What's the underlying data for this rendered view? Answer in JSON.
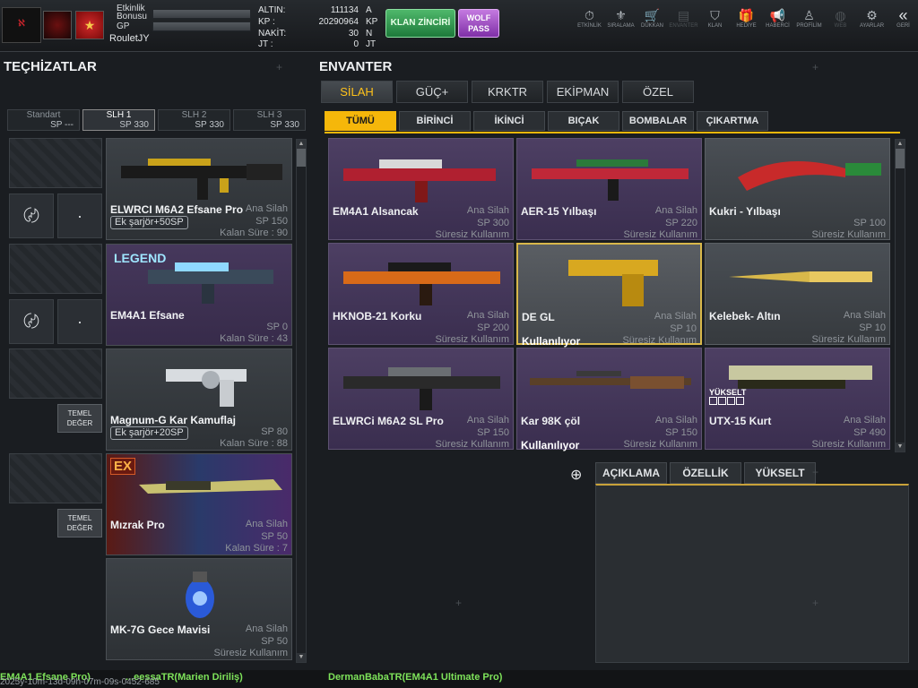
{
  "topbar": {
    "stat_labels": [
      "Etkinlik",
      "Bonusu",
      "GP"
    ],
    "username": "RouletJY",
    "currencies": [
      {
        "label": "ALTIN:",
        "value": "111134",
        "unit": "A"
      },
      {
        "label": "KP  :",
        "value": "20290964",
        "unit": "KP"
      },
      {
        "label": "NAKİT:",
        "value": "30",
        "unit": "N"
      },
      {
        "label": "JT   :",
        "value": "0",
        "unit": "JT"
      }
    ],
    "clan_button": "KLAN ZİNCİRİ",
    "wolf_button_line1": "WOLF",
    "wolf_button_line2": "PASS",
    "nav": [
      {
        "label": "ETKİNLİK",
        "icon": "stopwatch-icon",
        "glyph": "⏱"
      },
      {
        "label": "SIRALAMA",
        "icon": "medal-icon",
        "glyph": "⚜"
      },
      {
        "label": "DÜKKAN",
        "icon": "cart-icon",
        "glyph": "🛒"
      },
      {
        "label": "ENVANTER",
        "icon": "inventory-icon",
        "glyph": "▤"
      },
      {
        "label": "KLAN",
        "icon": "shield-icon",
        "glyph": "⛉"
      },
      {
        "label": "HEDİYE",
        "icon": "gift-icon",
        "glyph": "🎁"
      },
      {
        "label": "HABERCİ",
        "icon": "megaphone-icon",
        "glyph": "📢"
      },
      {
        "label": "PROFİLİM",
        "icon": "profile-icon",
        "glyph": "♙"
      },
      {
        "label": "WEB",
        "icon": "globe-icon",
        "glyph": "◍"
      },
      {
        "label": "AYARLAR",
        "icon": "gear-icon",
        "glyph": "⚙"
      },
      {
        "label": "GERİ",
        "icon": "back-icon",
        "glyph": "«"
      }
    ]
  },
  "left": {
    "title": "TEÇHİZATLAR",
    "loadouts": [
      {
        "name": "Standart",
        "sp": "SP ---"
      },
      {
        "name": "SLH 1",
        "sp": "SP 330"
      },
      {
        "name": "SLH 2",
        "sp": "SP 330"
      },
      {
        "name": "SLH 3",
        "sp": "SP 330"
      }
    ],
    "value_button_line1": "TEMEL",
    "value_button_line2": "DEĞER",
    "items": [
      {
        "name": "ELWRCI M6A2 Efsane Pro",
        "type": "Ana Silah",
        "sp": "SP 150",
        "remain": "Kalan Süre : 90",
        "extra": "Ek şarjör+50SP"
      },
      {
        "name": "EM4A1 Efsane",
        "sp": "SP 0",
        "remain": "Kalan Süre : 43",
        "badge": "LEGEND"
      },
      {
        "name": "Magnum-G Kar Kamuflaj",
        "sp": "SP 80",
        "remain": "Kalan Süre : 88",
        "extra": "Ek şarjör+20SP"
      },
      {
        "name": "Mızrak Pro",
        "type": "Ana Silah",
        "sp": "SP 50",
        "remain": "Kalan Süre : 7",
        "badge": "EX"
      },
      {
        "name": "MK-7G Gece Mavisi",
        "type": "Ana Silah",
        "sp": "SP 50",
        "remain": "Süresiz Kullanım"
      }
    ]
  },
  "inventory": {
    "title": "ENVANTER",
    "main_tabs": [
      "SİLAH",
      "GÜÇ+",
      "KRKTR",
      "EKİPMAN",
      "ÖZEL"
    ],
    "sub_tabs": [
      "TÜMÜ",
      "BİRİNCİ",
      "İKİNCİ",
      "BIÇAK",
      "BOMBALAR",
      "ÇIKARTMA"
    ],
    "upgrade_label": "YÜKSELT",
    "items": [
      {
        "name": "EM4A1 Alsancak",
        "type": "Ana Silah",
        "sp": "SP 300",
        "remain": "Süresiz Kullanım"
      },
      {
        "name": "AER-15 Yılbaşı",
        "type": "Ana Silah",
        "sp": "SP 220",
        "remain": "Süresiz Kullanım"
      },
      {
        "name": "Kukri - Yılbaşı",
        "sp": "SP 100",
        "remain": "Süresiz Kullanım"
      },
      {
        "name": "HKNOB-21 Korku",
        "type": "Ana Silah",
        "sp": "SP 200",
        "remain": "Süresiz Kullanım"
      },
      {
        "name": "DE GL",
        "type": "Ana Silah",
        "sp": "SP 10",
        "remain": "Süresiz Kullanım",
        "status": "Kullanılıyor"
      },
      {
        "name": "Kelebek- Altın",
        "type": "Ana Silah",
        "sp": "SP 10",
        "remain": "Süresiz Kullanım"
      },
      {
        "name": "ELWRCi M6A2 SL Pro",
        "type": "Ana Silah",
        "sp": "SP 150",
        "remain": "Süresiz Kullanım"
      },
      {
        "name": "Kar 98K çöl",
        "type": "Ana Silah",
        "sp": "SP 150",
        "remain": "Süresiz Kullanım",
        "status": "Kullanılıyor"
      },
      {
        "name": "UTX-15 Kurt",
        "type": "Ana Silah",
        "sp": "SP 490",
        "remain": "Süresiz Kullanım"
      }
    ],
    "detail_tabs": [
      "AÇIKLAMA",
      "ÖZELLİK",
      "YÜKSELT"
    ]
  },
  "chat": {
    "msg1": "EM4A1 Efsane Pro)",
    "msg2": "...eessaTR(Marien Diriliş)",
    "msg3": "DermanBabaTR(EM4A1 Ultimate Pro)",
    "timestamp": "2025y-10m-13d-09h-07m-09s-0452-685"
  },
  "colors": {
    "accent": "#f5b70a",
    "item_purple": "#46385c",
    "selected_border": "#d9b84a",
    "chat_green": "#7ee35a"
  }
}
